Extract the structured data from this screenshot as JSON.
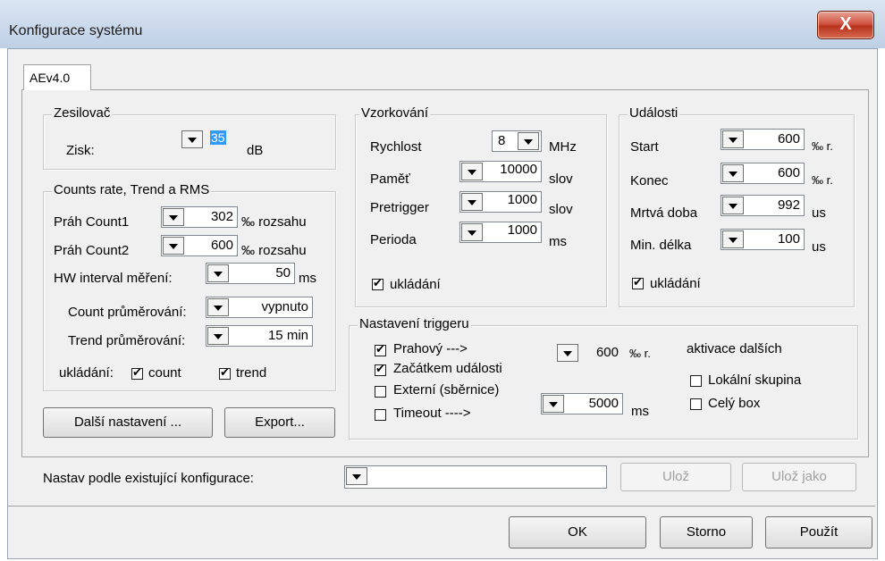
{
  "window": {
    "title": "Konfigurace systému",
    "close_label": "X"
  },
  "tab": {
    "label": "AEv4.0"
  },
  "zesilovac": {
    "legend": "Zesilovač",
    "zisk_label": "Zisk:",
    "zisk_value": "35",
    "zisk_unit": "dB"
  },
  "counts": {
    "legend": "Counts rate, Trend a RMS",
    "prah1_label": "Práh Count1",
    "prah1_value": "302",
    "prah1_unit": "‰ rozsahu",
    "prah2_label": "Práh Count2",
    "prah2_value": "600",
    "prah2_unit": "‰ rozsahu",
    "hw_label": "HW interval měření:",
    "hw_value": "50",
    "hw_unit": "ms",
    "count_avg_label": "Count průměrování:",
    "count_avg_value": "vypnuto",
    "trend_avg_label": "Trend průměrování:",
    "trend_avg_value": "15 min",
    "save_label": "ukládání:",
    "count_chk": "count",
    "trend_chk": "trend"
  },
  "buttons": {
    "dalsi": "Další nastavení ...",
    "export": "Export...",
    "uloz": "Ulož",
    "uloz_jako": "Ulož jako",
    "ok": "OK",
    "storno": "Storno",
    "pouzit": "Použít"
  },
  "vzorkovani": {
    "legend": "Vzorkování",
    "rychlost_label": "Rychlost",
    "rychlost_value": "8",
    "rychlost_unit": "MHz",
    "pamet_label": "Paměť",
    "pamet_value": "10000",
    "pamet_unit": "slov",
    "pretrigger_label": "Pretrigger",
    "pretrigger_value": "1000",
    "pretrigger_unit": "slov",
    "perioda_label": "Perioda",
    "perioda_value": "1000",
    "perioda_unit": "ms",
    "ukladani": "ukládání"
  },
  "udalosti": {
    "legend": "Události",
    "start_label": "Start",
    "start_value": "600",
    "start_unit": "‰ r.",
    "konec_label": "Konec",
    "konec_value": "600",
    "konec_unit": "‰ r.",
    "mrtva_label": "Mrtvá doba",
    "mrtva_value": "992",
    "mrtva_unit": "us",
    "min_label": "Min. délka",
    "min_value": "100",
    "min_unit": "us",
    "ukladani": "ukládání"
  },
  "trigger": {
    "legend": "Nastavení triggeru",
    "prahovy": "Prahový   --->",
    "prahovy_value": "600",
    "prahovy_unit": "‰ r.",
    "zacatkem": "Začátkem události",
    "externi": "Externí (sběrnice)",
    "timeout": "Timeout  ---->",
    "timeout_value": "5000",
    "timeout_unit": "ms",
    "aktivace": "aktivace dalších",
    "lokalni": "Lokální skupina",
    "cely": "Celý box"
  },
  "nastav": {
    "label": "Nastav podle existující konfigurace:",
    "value": ""
  }
}
